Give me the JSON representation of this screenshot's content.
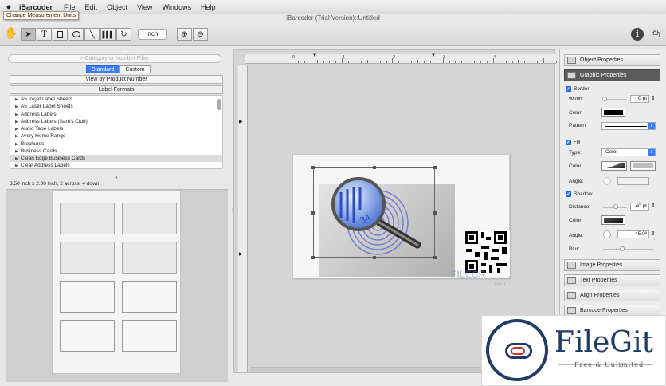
{
  "menubar": {
    "apple": "",
    "app_name": "iBarcoder",
    "items": [
      "File",
      "Edit",
      "Object",
      "View",
      "Windows",
      "Help"
    ]
  },
  "tooltip": "Change Measurement Units",
  "window_title": "iBarcoder (Trial Version)::Untitled",
  "toolbar": {
    "tools": [
      "select-tool",
      "text-tool",
      "rectangle-tool",
      "ellipse-tool",
      "line-tool",
      "barcode-tool",
      "rotate-tool"
    ],
    "unit": "inch",
    "zoom": [
      "zoom-in",
      "zoom-out"
    ]
  },
  "left": {
    "search_placeholder": "Category or Number Filter",
    "segments": [
      "Standard",
      "Custom"
    ],
    "view_button": "View by Product Number",
    "formats_header": "Label Formats",
    "formats": [
      "A5 Inkjet Label Sheets",
      "A5 Laser Label Sheets",
      "Address Labels",
      "Address Labels (Sam's Club)",
      "Audio Tape Labels",
      "Avery Home Range",
      "Brochures",
      "Business Cards",
      "Clean Edge  Business Cards",
      "Clear Address Labels"
    ],
    "selected_format_index": 8,
    "dimensions": "3.50 inch x 2.00 inch, 2 across, 4 down"
  },
  "ruler": {
    "top_numbers": [
      "0",
      "1",
      "2",
      "3",
      "4"
    ]
  },
  "canvas_watermark": {
    "text": "FILECR",
    "com": ".com"
  },
  "right": {
    "object_properties": "Object Properties",
    "graphic_properties": "Graphic Properties",
    "border": {
      "label": "Border",
      "width_label": "Width:",
      "width_value": "0 pt",
      "color_label": "Color:",
      "color": "#000000",
      "pattern_label": "Pattern:"
    },
    "fill": {
      "label": "Fill",
      "type_label": "Type:",
      "type_value": "Color",
      "color_label": "Color:",
      "angle_label": "Angle:"
    },
    "shadow": {
      "label": "Shadow",
      "distance_label": "Distance:",
      "distance_value": "40 pt",
      "color_label": "Color:",
      "angle_label": "Angle:",
      "angle_value": "45.0º",
      "blur_label": "Blur:"
    },
    "image_properties": "Image Properties",
    "text_properties": "Text Properties",
    "align_properties": "Align Properties",
    "barcode_properties": "Barcode Properties"
  },
  "filegit": {
    "title": "FileGit",
    "subtitle": "Free & Unlimited"
  }
}
